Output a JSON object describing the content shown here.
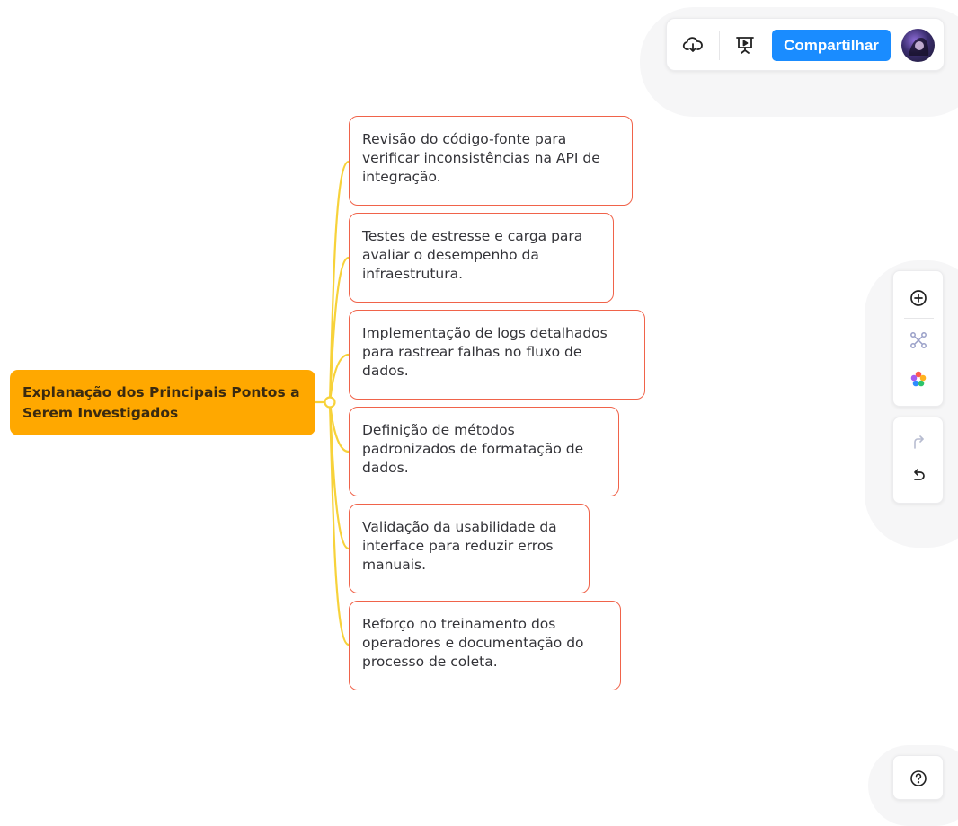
{
  "toolbar": {
    "icons": [
      "cloud-download-icon",
      "presentation-play-icon"
    ],
    "share_label": "Compartilhar"
  },
  "mindmap": {
    "root": "Explanação dos Principais Pontos a Serem Investigados",
    "children": [
      "Revisão do código-fonte para verificar inconsistências na API de integração.",
      "Testes de estresse e carga para avaliar o desempenho da infraestrutura.",
      "Implementação de logs detalhados para rastrear falhas no fluxo de dados.",
      "Definição de métodos padronizados de formatação de dados.",
      "Validação da usabilidade da interface para reduzir erros manuais.",
      "Reforço no treinamento dos operadores e documentação do processo de coleta."
    ]
  },
  "side_tools": {
    "icons": [
      "add-node-icon",
      "structure-icon",
      "theme-palette-icon",
      "redo-icon",
      "undo-icon"
    ]
  },
  "help": {
    "icon": "help-icon"
  },
  "colors": {
    "root_fill": "#ffa800",
    "child_border": "#f0634a",
    "connector": "#f7d23a",
    "share_button": "#1a8cff"
  }
}
